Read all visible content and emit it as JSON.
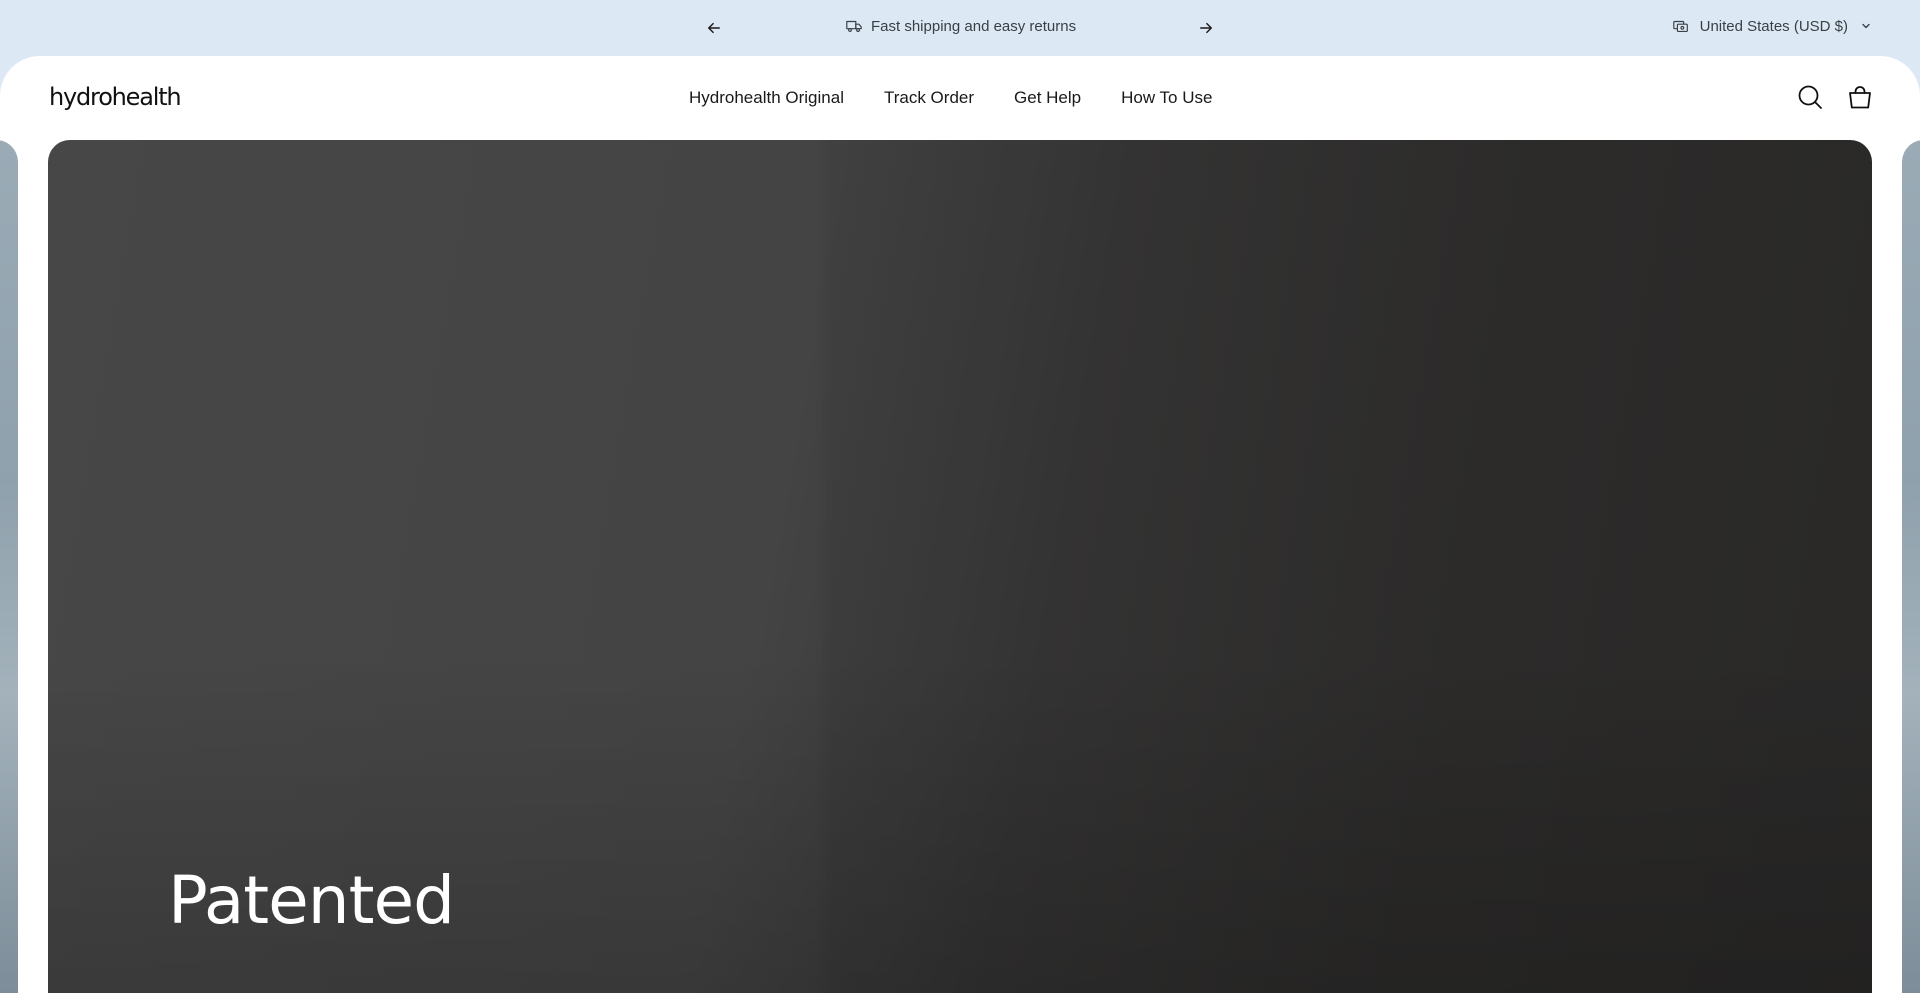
{
  "announcement": {
    "message": "Fast shipping and easy returns",
    "message_icon": "truck-icon",
    "prev_icon": "arrow-left-icon",
    "next_icon": "arrow-right-icon"
  },
  "localization": {
    "country": "United States (USD $)",
    "icon": "currency-icon",
    "dropdown_icon": "chevron-down-icon"
  },
  "header": {
    "logo": "hydrohealth",
    "nav": [
      {
        "label": "Hydrohealth Original"
      },
      {
        "label": "Track Order"
      },
      {
        "label": "Get Help"
      },
      {
        "label": "How To Use"
      }
    ],
    "search_icon": "search-icon",
    "cart_icon": "shopping-bag-icon"
  },
  "hero": {
    "heading": "Patented"
  },
  "colors": {
    "announcement_bg": "#dce9f4",
    "text_dark": "#1a1a1a",
    "hero_bg_left": "#474747",
    "hero_bg_right": "#2c2b2a",
    "hero_text": "#ffffff"
  }
}
